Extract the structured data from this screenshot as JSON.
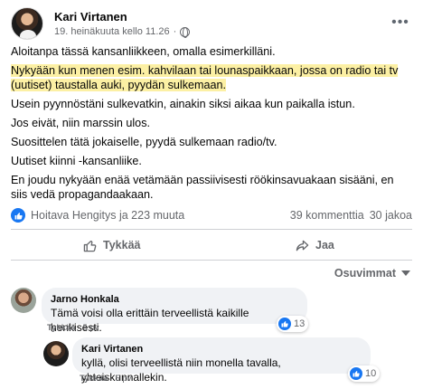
{
  "post": {
    "author": "Kari Virtanen",
    "timestamp": "19. heinäkuuta kello 11.26",
    "privacy_separator": "·",
    "more_icon": "more-horizontal-icon",
    "paragraphs": [
      "Aloitanpa tässä kansanliikkeen, omalla esimerkilläni.",
      "Nykyään kun menen esim. kahvilaan tai lounaspaikkaan, jossa on radio tai tv (uutiset) taustalla auki, pyydän sulkemaan.",
      "Usein pyynnöstäni sulkevatkin, ainakin siksi aikaa kun paikalla istun.",
      "Jos eivät, niin marssin ulos.",
      "Suosittelen tätä jokaiselle, pyydä sulkemaan radio/tv.",
      "Uutiset kiinni -kansanliike.",
      "En joudu nykyään enää vetämään passiivisesti röökinsavuakaan sisääni, en siis vedä propagandaakaan."
    ],
    "highlighted_paragraph_index": 1
  },
  "reactions": {
    "summary": "Hoitava Hengitys ja 223 muuta",
    "comments": "39 kommenttia",
    "shares": "30 jakoa"
  },
  "actions": {
    "like_label": "Tykkää",
    "share_label": "Jaa"
  },
  "comments_sort": {
    "label": "Osuvimmat"
  },
  "comments": [
    {
      "author": "Jarno Honkala",
      "text": "Tämä voisi olla erittäin terveellistä kaikille henkisesti.",
      "like_count": "13",
      "like_action": "Tykkää",
      "age": "5 pv"
    },
    {
      "author": "Kari Virtanen",
      "text": "kyllä, olisi terveellistä niin monella tavalla, yhteiskunnallekin.",
      "like_count": "10",
      "like_action": "Tykkää",
      "age": "5 pv"
    }
  ],
  "colors": {
    "accent": "#1877f2",
    "highlight": "#fcf0a4",
    "secondary_text": "#65676b",
    "bubble": "#f0f2f5"
  }
}
